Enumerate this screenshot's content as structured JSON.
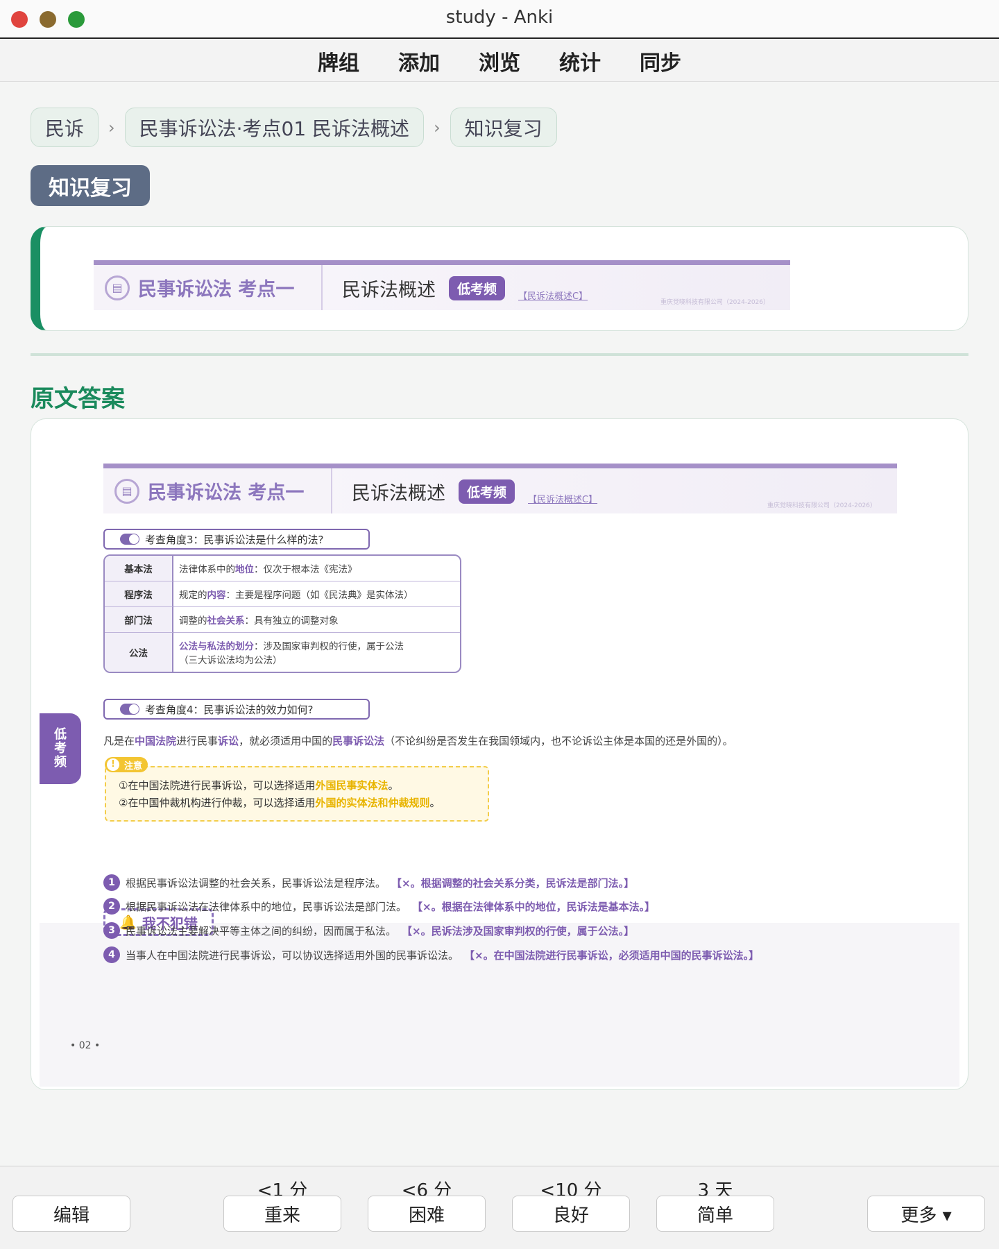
{
  "window": {
    "title": "study - Anki"
  },
  "toolbar": {
    "items": [
      "牌组",
      "添加",
      "浏览",
      "统计",
      "同步"
    ]
  },
  "breadcrumb": {
    "items": [
      "民诉",
      "民事诉讼法·考点01 民诉法概述",
      "知识复习"
    ],
    "separator": "›"
  },
  "tag": "知识复习",
  "section_title": "原文答案",
  "banner": {
    "topic": "民事诉讼法 考点一",
    "title": "民诉法概述",
    "badge": "低考频",
    "ref": "【民诉法概述C】",
    "copyright": "重庆觉晓科技有限公司（2024-2026）"
  },
  "angle3": {
    "label": "考查角度3：民事诉讼法是什么样的法?"
  },
  "table": [
    {
      "key": "基本法",
      "pre": "法律体系中的",
      "hl": "地位",
      "post": "：仅次于根本法《宪法》"
    },
    {
      "key": "程序法",
      "pre": "规定的",
      "hl": "内容",
      "post": "：主要是程序问题（如《民法典》是实体法）"
    },
    {
      "key": "部门法",
      "pre": "调整的",
      "hl": "社会关系",
      "post": "：具有独立的调整对象"
    },
    {
      "key": "公法",
      "pre": "",
      "hl": "公法与私法的划分",
      "post": "：涉及国家审判权的行使，属于公法",
      "line2": "（三大诉讼法均为公法）"
    }
  ],
  "angle4": {
    "label": "考查角度4：民事诉讼法的效力如何?"
  },
  "side_tab": "低考频",
  "para": {
    "p1": "凡是在",
    "h1": "中国法院",
    "p2": "进行民事",
    "h2": "诉讼",
    "p3": "，就必须适用中国的",
    "h3": "民事诉讼法",
    "p4": "（不论纠纷是否发生在我国领域内，也不论诉讼主体是本国的还是外国的）。"
  },
  "note": {
    "tag": "注意",
    "icon": "warning-icon",
    "l1a": "①在中国法院进行民事诉讼，可以选择适用",
    "l1b": "外国民事实体法",
    "l1c": "。",
    "l2a": "②在中国仲裁机构进行仲裁，可以选择适用",
    "l2b": "外国的实体法和仲裁规则",
    "l2c": "。"
  },
  "mistakes": {
    "title": "我不犯错",
    "items": [
      {
        "n": "1",
        "text": "根据民事诉讼法调整的社会关系，民事诉讼法是程序法。",
        "ans": "【×。根据调整的社会关系分类，民诉法是部门法。】"
      },
      {
        "n": "2",
        "text": "根据民事诉讼法在法律体系中的地位，民事诉讼法是部门法。",
        "ans": "【×。根据在法律体系中的地位，民诉法是基本法。】"
      },
      {
        "n": "3",
        "text": "民事诉讼法主要解决平等主体之间的纠纷，因而属于私法。",
        "ans": "【×。民诉法涉及国家审判权的行使，属于公法。】"
      },
      {
        "n": "4",
        "text": "当事人在中国法院进行民事诉讼，可以协议选择适用外国的民事诉讼法。",
        "ans": "【×。在中国法院进行民事诉讼，必须适用中国的民事诉讼法。】"
      }
    ]
  },
  "page_number": "• 02 •",
  "answer": {
    "edit": "编辑",
    "more": "更多 ▾",
    "buttons": [
      {
        "label": "重来",
        "interval": "<1 分"
      },
      {
        "label": "困难",
        "interval": "<6 分"
      },
      {
        "label": "良好",
        "interval": "<10 分"
      },
      {
        "label": "简单",
        "interval": "3 天"
      }
    ]
  },
  "colors": {
    "accent": "#1a8f63",
    "purple": "#7d5cb0",
    "yellow": "#f3c532",
    "tag": "#5d6c85"
  }
}
